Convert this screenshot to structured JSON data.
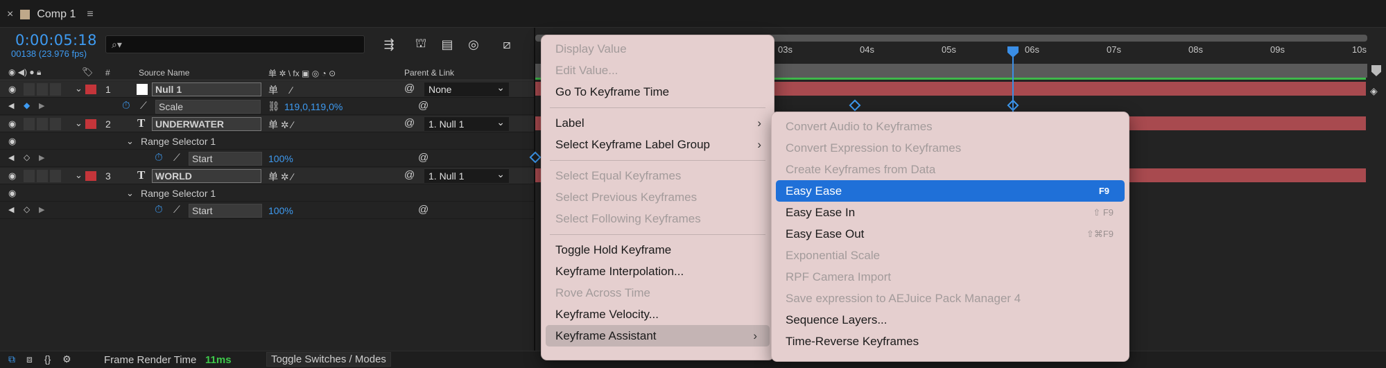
{
  "tab": {
    "title": "Comp 1",
    "close": "×",
    "menu": "≡"
  },
  "header": {
    "timecode": "0:00:05:18",
    "framecount": "00138 (23.976 fps)",
    "search_placeholder": "⌕▾"
  },
  "columns": {
    "hash": "#",
    "source_name": "Source Name",
    "switches": "单 ✲ \\ fx ▣ ◎ ◔ ⊙",
    "parent": "Parent & Link"
  },
  "layers": [
    {
      "num": "1",
      "name": "Null 1",
      "parent": "None",
      "prop_name": "Scale",
      "prop_value": "119,0,119,0%"
    },
    {
      "num": "2",
      "name": "UNDERWATER",
      "parent": "1. Null 1",
      "selector": "Range Selector 1",
      "prop_name": "Start",
      "prop_value": "100%"
    },
    {
      "num": "3",
      "name": "WORLD",
      "parent": "1. Null 1",
      "selector": "Range Selector 1",
      "prop_name": "Start",
      "prop_value": "100%"
    }
  ],
  "ruler": {
    "ticks": [
      "03s",
      "04s",
      "05s",
      "06s",
      "07s",
      "08s",
      "09s",
      "10s"
    ],
    "start": "0s"
  },
  "bottom": {
    "render_label": "Frame Render Time",
    "render_value": "11ms",
    "toggle": "Toggle Switches / Modes"
  },
  "context_menu": {
    "items": [
      {
        "label": "Display Value"
      },
      {
        "label": "Edit Value..."
      },
      {
        "label": "Go To Keyframe Time"
      },
      {
        "label": "Label"
      },
      {
        "label": "Select Keyframe Label Group"
      },
      {
        "label": "Select Equal Keyframes"
      },
      {
        "label": "Select Previous Keyframes"
      },
      {
        "label": "Select Following Keyframes"
      },
      {
        "label": "Toggle Hold Keyframe"
      },
      {
        "label": "Keyframe Interpolation..."
      },
      {
        "label": "Rove Across Time"
      },
      {
        "label": "Keyframe Velocity..."
      },
      {
        "label": "Keyframe Assistant"
      }
    ]
  },
  "submenu": {
    "items": [
      {
        "label": "Convert Audio to Keyframes"
      },
      {
        "label": "Convert Expression to Keyframes"
      },
      {
        "label": "Create Keyframes from Data"
      },
      {
        "label": "Easy Ease",
        "shortcut": "F9"
      },
      {
        "label": "Easy Ease In",
        "shortcut": "⇧ F9"
      },
      {
        "label": "Easy Ease Out",
        "shortcut": "⇧⌘F9"
      },
      {
        "label": "Exponential Scale"
      },
      {
        "label": "RPF Camera Import"
      },
      {
        "label": "Save expression to AEJuice Pack Manager 4"
      },
      {
        "label": "Sequence Layers..."
      },
      {
        "label": "Time-Reverse Keyframes"
      }
    ]
  },
  "colors": {
    "accent": "#3e9bf2",
    "layer_label": "#c4353a",
    "highlight": "#1f70d8",
    "menu_bg": "#e5cfcf",
    "bar": "#a84a4f"
  }
}
